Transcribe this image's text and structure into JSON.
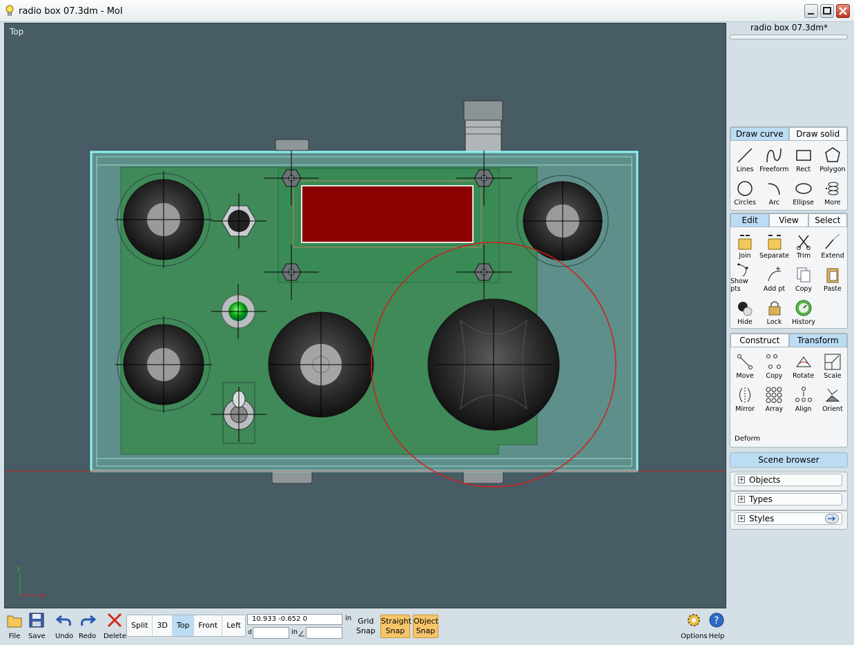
{
  "window": {
    "title": "radio box 07.3dm - MoI",
    "app_icon": "lightbulb-icon"
  },
  "viewport": {
    "label": "Top",
    "axis_x": "x",
    "axis_y": "y"
  },
  "panel": {
    "doc_title": "radio box 07.3dm*",
    "draw_tabs": [
      "Draw curve",
      "Draw solid"
    ],
    "draw_tools": [
      "Lines",
      "Freeform",
      "Rect",
      "Polygon",
      "Circles",
      "Arc",
      "Ellipse",
      "More"
    ],
    "edit_tabs": [
      "Edit",
      "View",
      "Select"
    ],
    "edit_tools": [
      "Join",
      "Separate",
      "Trim",
      "Extend",
      "Show pts",
      "Add pt",
      "Copy",
      "Paste",
      "Hide",
      "Lock",
      "History"
    ],
    "construct_tabs": [
      "Construct",
      "Transform"
    ],
    "transform_tools": [
      "Move",
      "Copy",
      "Rotate",
      "Scale",
      "Mirror",
      "Array",
      "Align",
      "Orient"
    ],
    "deform_label": "Deform",
    "scene_browser": "Scene browser",
    "scene_sections": [
      "Objects",
      "Types",
      "Styles"
    ]
  },
  "toolbar": {
    "file": "File",
    "save": "Save",
    "undo": "Undo",
    "redo": "Redo",
    "delete": "Delete",
    "views": [
      "Split",
      "3D",
      "Top",
      "Front",
      "Left"
    ],
    "active_view": "Top",
    "coords": "10.933    -0.652      0",
    "units": "in",
    "d_label": "d",
    "grid_snap_1": "Grid",
    "grid_snap_2": "Snap",
    "straight_snap_1": "Straight",
    "straight_snap_2": "Snap",
    "object_snap_1": "Object",
    "object_snap_2": "Snap",
    "options": "Options",
    "help": "Help"
  },
  "colors": {
    "accent_tab": "#bcdcf4",
    "snap_active": "#f6c56a",
    "viewport_bg": "#475c64",
    "selection": "#7fe6e6",
    "circle": "#d21e1e"
  }
}
